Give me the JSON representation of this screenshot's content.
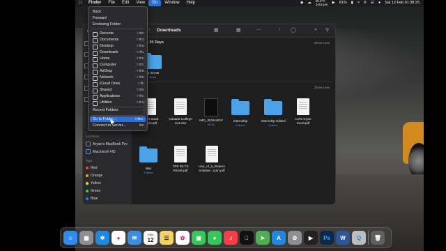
{
  "menubar": {
    "app_name": "Finder",
    "items": [
      "File",
      "Edit",
      "View",
      "Go",
      "Window",
      "Help"
    ],
    "temperature": "65.3°C",
    "temperature_sub": "3451rpm",
    "battery": "81%",
    "datetime": "Sat 12 Feb  01:38:25"
  },
  "go_menu": {
    "items": [
      {
        "label": "Back",
        "shortcut": ""
      },
      {
        "label": "Forward",
        "shortcut": ""
      },
      {
        "label": "Enclosing Folder",
        "shortcut": ""
      },
      {
        "label": "Recents",
        "shortcut": "⇧⌘F",
        "icon": "clock-icon"
      },
      {
        "label": "Documents",
        "shortcut": "⇧⌘O",
        "icon": "document-icon"
      },
      {
        "label": "Desktop",
        "shortcut": "⇧⌘D",
        "icon": "desktop-icon"
      },
      {
        "label": "Downloads",
        "shortcut": "⌥⌘L",
        "icon": "download-icon"
      },
      {
        "label": "Home",
        "shortcut": "⇧⌘H",
        "icon": "home-icon"
      },
      {
        "label": "Computer",
        "shortcut": "⇧⌘C",
        "icon": "computer-icon"
      },
      {
        "label": "AirDrop",
        "shortcut": "⇧⌘R",
        "icon": "airdrop-icon"
      },
      {
        "label": "Network",
        "shortcut": "⇧⌘K",
        "icon": "network-icon"
      },
      {
        "label": "iCloud Drive",
        "shortcut": "⇧⌘I",
        "icon": "cloud-icon"
      },
      {
        "label": "Shared",
        "shortcut": "⇧⌘S",
        "icon": "shared-icon"
      },
      {
        "label": "Applications",
        "shortcut": "⇧⌘A",
        "icon": "applications-icon"
      },
      {
        "label": "Utilities",
        "shortcut": "⇧⌘U",
        "icon": "utilities-icon"
      }
    ],
    "recent_folders": "Recent Folders",
    "go_to_folder": "Go to Folder...",
    "go_to_folder_shortcut": "⇧⌘G",
    "connect_to_server": "Connect to Server...",
    "connect_shortcut": "⌘K"
  },
  "finder": {
    "title": "Downloads",
    "sidebar": {
      "locations_header": "Locations",
      "locations": [
        "Aryan's MacBook Pro",
        "Macintosh HD"
      ],
      "tags_header": "Tags",
      "tags": [
        {
          "label": "Red",
          "color": "#ff453a"
        },
        {
          "label": "Orange",
          "color": "#ff9f0a"
        },
        {
          "label": "Yellow",
          "color": "#ffd60a"
        },
        {
          "label": "Green",
          "color": "#30d158"
        },
        {
          "label": "Blue",
          "color": "#0a84ff"
        }
      ]
    },
    "section1": {
      "title": "ous 30 Days",
      "show_less": "Show Less"
    },
    "section2": {
      "show_less": "Show Less"
    },
    "file_saab": {
      "name": "ay SAAB",
      "sub": "items"
    },
    "files": [
      {
        "name": "Aryan Sood\nCheet.pdf",
        "type": "doc"
      },
      {
        "name": "Canada College\nList.xlsx",
        "type": "doc"
      },
      {
        "name": "IMG_3536.MOV",
        "sub": "00:11",
        "type": "video"
      },
      {
        "name": "Internship",
        "sub": "6 items",
        "type": "folder"
      },
      {
        "name": "Internship Edited",
        "sub": "2 items",
        "type": "folder"
      },
      {
        "name": "LOR Aryan\nSood.pdf",
        "type": "doc"
      }
    ],
    "files_row2": [
      {
        "name": "Mac",
        "sub": "8 items",
        "type": "folder"
      },
      {
        "name": "TRF IELTS\nResult.pdf",
        "type": "doc"
      },
      {
        "name": "Use_of_a_Repres\nentative...ryan.pdf",
        "type": "doc"
      }
    ]
  },
  "dock": {
    "calendar_month": "FEB",
    "calendar_day": "12",
    "apps": [
      "finder",
      "launchpad",
      "safari",
      "chrome",
      "mail",
      "calendar",
      "notes",
      "photos",
      "facetime",
      "messages",
      "music",
      "tv",
      "maps",
      "app-store",
      "system-preferences",
      "final-cut",
      "photoshop",
      "word",
      "quicktime",
      "trash"
    ]
  }
}
